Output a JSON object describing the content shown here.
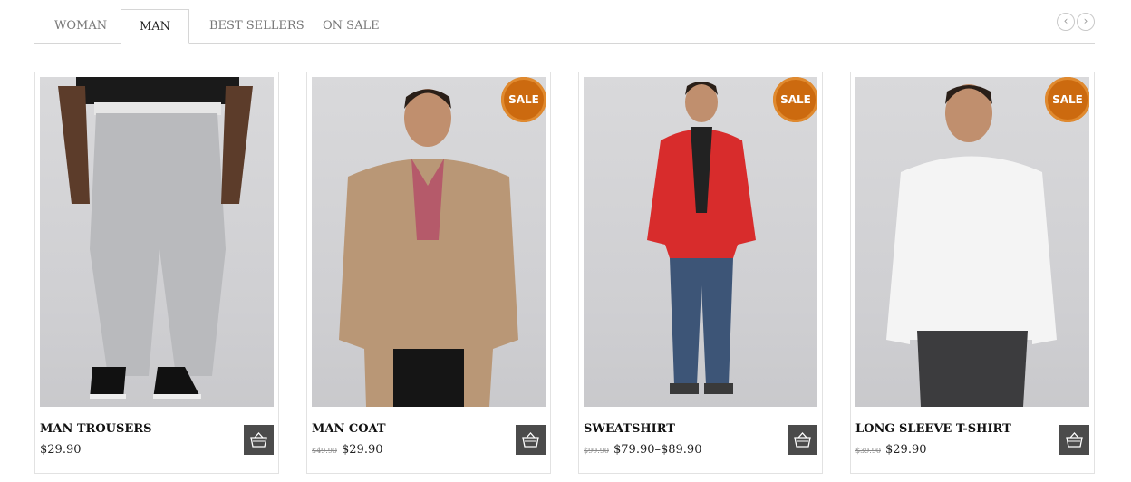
{
  "tabs": [
    {
      "label": "WOMAN",
      "active": false
    },
    {
      "label": "MAN",
      "active": true
    },
    {
      "label": "BEST SELLERS",
      "active": false
    },
    {
      "label": "ON SALE",
      "active": false
    }
  ],
  "nav": {
    "prev_icon": "chevron-left-icon",
    "next_icon": "chevron-right-icon"
  },
  "colors": {
    "sale_badge": "#cc6a0f",
    "cart_button": "#4b4b4b"
  },
  "products": [
    {
      "name": "MAN TROUSERS",
      "old_price": "",
      "price": "$29.90",
      "sale": false,
      "sale_label": ""
    },
    {
      "name": "MAN COAT",
      "old_price": "$49.90",
      "price": "$29.90",
      "sale": true,
      "sale_label": "SALE"
    },
    {
      "name": "SWEATSHIRT",
      "old_price": "$99.90",
      "price": "$79.90–$89.90",
      "sale": true,
      "sale_label": "SALE"
    },
    {
      "name": "LONG SLEEVE T-SHIRT",
      "old_price": "$39.90",
      "price": "$29.90",
      "sale": true,
      "sale_label": "SALE"
    }
  ]
}
